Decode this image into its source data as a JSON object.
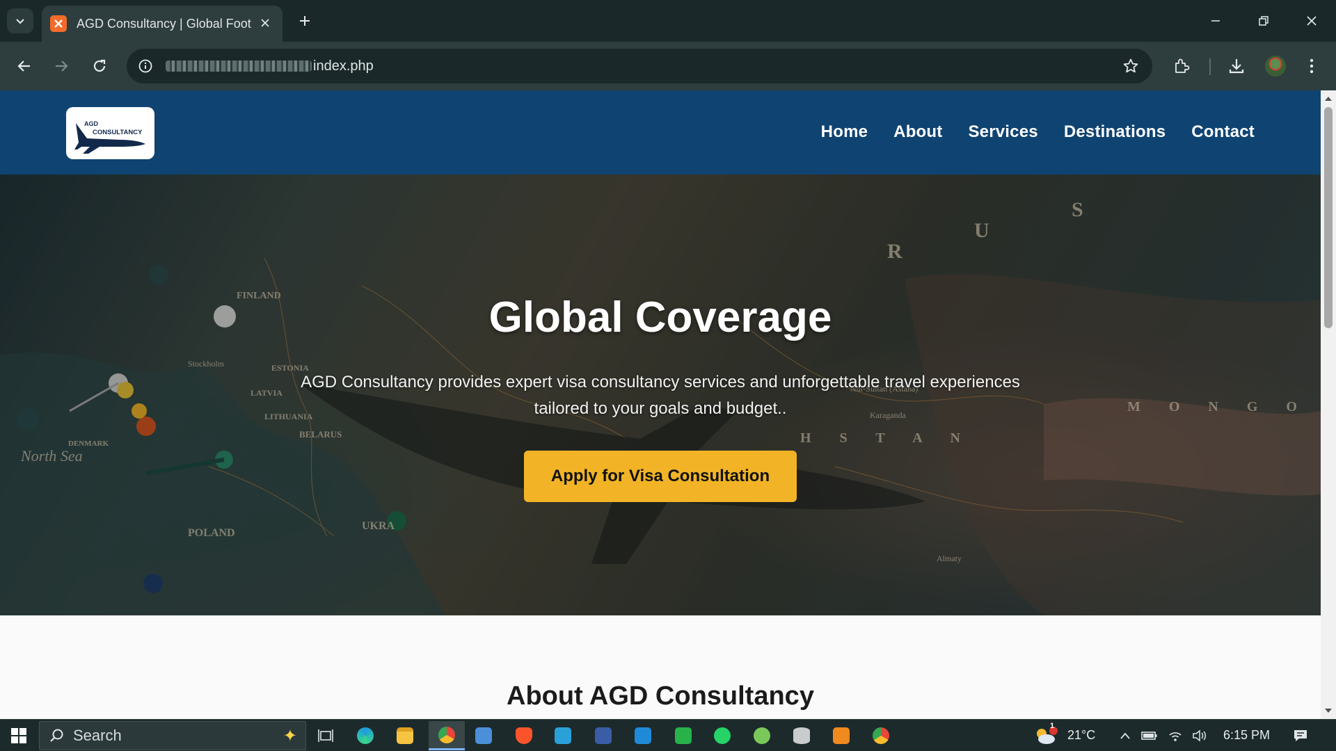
{
  "browser": {
    "tab": {
      "title": "AGD Consultancy | Global Foot",
      "favicon": "xampp-favicon-icon"
    },
    "address_bar": {
      "url_visible": "index.php"
    },
    "colors": {
      "chrome_dark": "#1b2829",
      "chrome_toolbar": "#2e3d3e"
    }
  },
  "site": {
    "logo": {
      "line1": "AGD",
      "line2": "CONSULTANCY"
    },
    "nav": [
      {
        "label": "Home"
      },
      {
        "label": "About"
      },
      {
        "label": "Services"
      },
      {
        "label": "Destinations"
      },
      {
        "label": "Contact"
      }
    ],
    "hero": {
      "title": "Global Coverage",
      "subtitle": "AGD Consultancy provides expert visa consultancy services and unforgettable travel experiences tailored to your goals and budget..",
      "cta_label": "Apply for Visa Consultation",
      "map_labels": [
        "FINLAND",
        "ESTONIA",
        "LATVIA",
        "LITHUANIA",
        "BELARUS",
        "DENMARK",
        "North Sea",
        "R",
        "U",
        "S",
        "H S T A N",
        "M O N G O",
        "Stockholm",
        "Almaty",
        "Nur-Sultan (Astana)",
        "Karaganda",
        "UKRA",
        "POLAND"
      ]
    },
    "about": {
      "title": "About AGD Consultancy"
    },
    "colors": {
      "header": "#0f4371",
      "cta": "#f2b426",
      "page_bg": "#fafafa"
    }
  },
  "taskbar": {
    "search_label": "Search",
    "weather": {
      "temp": "21°C",
      "badge": "1"
    },
    "time": "6:15 PM",
    "apps": [
      "task-view-icon",
      "edge-icon",
      "file-explorer-icon",
      "chrome-icon",
      "app-icon",
      "brave-icon",
      "visual-studio-icon",
      "app-icon",
      "vscode-icon",
      "qc-icon",
      "whatsapp-icon",
      "cloud-app-icon",
      "database-icon",
      "app-icon",
      "chrome-icon"
    ]
  }
}
